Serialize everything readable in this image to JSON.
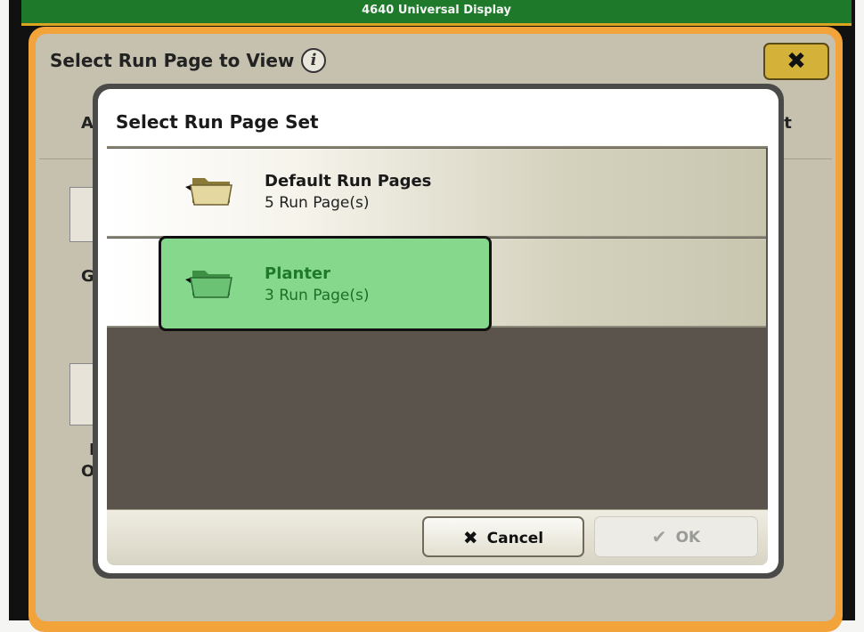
{
  "device": {
    "title": "4640 Universal Display"
  },
  "background_page": {
    "title": "Select Run Page to View",
    "info_icon": "info-icon",
    "close_icon": "close-icon",
    "fragments": {
      "left_a": "A",
      "right_et": "et",
      "left_g": "G",
      "left_f": "F",
      "left_o": "O"
    }
  },
  "dialog": {
    "title": "Select Run Page Set",
    "items": [
      {
        "name": "Default Run Pages",
        "subtitle": "5 Run Page(s)",
        "icon": "folder-icon",
        "selected": false
      },
      {
        "name": "Planter",
        "subtitle": "3 Run Page(s)",
        "icon": "folder-icon",
        "selected": true
      }
    ],
    "buttons": {
      "cancel": {
        "label": "Cancel",
        "icon": "x-icon"
      },
      "ok": {
        "label": "OK",
        "icon": "check-icon",
        "enabled": false
      }
    }
  },
  "colors": {
    "title_bar": "#1e7a2a",
    "accent_orange": "#f2a43a",
    "selected_item": "#86d88c",
    "selected_text": "#1e7a2a",
    "close_button": "#d4b23a"
  }
}
